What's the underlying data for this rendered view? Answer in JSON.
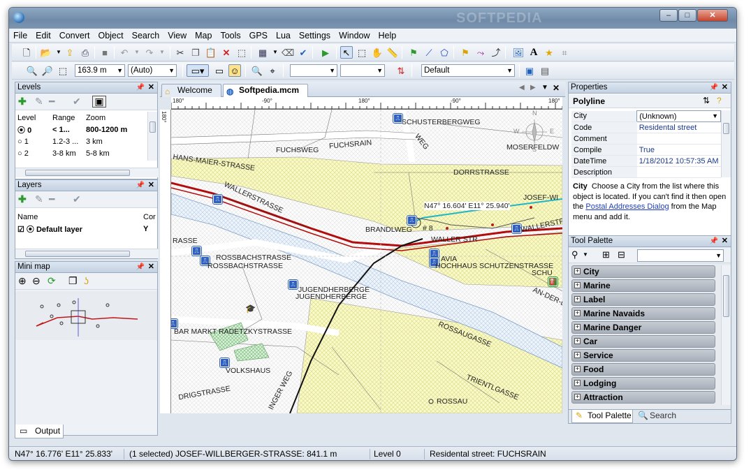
{
  "window": {
    "brand_watermark": "SOFTPEDIA",
    "min": "–",
    "max": "□",
    "close": "✕"
  },
  "menu": [
    "File",
    "Edit",
    "Convert",
    "Object",
    "Search",
    "View",
    "Map",
    "Tools",
    "GPS",
    "Lua",
    "Settings",
    "Window",
    "Help"
  ],
  "toolbar2": {
    "zoom_value": "163.9 m",
    "zoom_mode": "(Auto)",
    "style_value": "Default"
  },
  "levels_panel": {
    "title": "Levels",
    "columns": [
      "Level",
      "Range",
      "Zoom"
    ],
    "rows": [
      {
        "level": "0",
        "range": "< 1...",
        "zoom": "800-1200 m",
        "bold": true
      },
      {
        "level": "1",
        "range": "1.2-3 ...",
        "zoom": "3 km",
        "bold": false
      },
      {
        "level": "2",
        "range": "3-8 km",
        "zoom": "5-8 km",
        "bold": false
      }
    ]
  },
  "layers_panel": {
    "title": "Layers",
    "columns": [
      "Name",
      "Cor"
    ],
    "rows": [
      {
        "name": "Default layer",
        "flag": "Y"
      }
    ]
  },
  "minimap_panel": {
    "title": "Mini map"
  },
  "doc_tabs": [
    {
      "label": "Welcome"
    },
    {
      "label": "Softpedia.mcm"
    }
  ],
  "ruler_labels": [
    "180°",
    "-90°",
    "180°",
    "-90°",
    "180°",
    "180°"
  ],
  "map_labels": {
    "schusterbergweg": "SCHUSTERBERGWEG",
    "weg": "WEG",
    "fuchsweg": "FUCHSWEG",
    "fuchsrain": "FUCHSRAIN",
    "moserfeldweg": "MOSERFELDW",
    "hansmaier": "HANS-MAIER-STRASSE",
    "dorrstrasse": "DORRSTRASSE",
    "josefwi": "JOSEF-WI",
    "wallerstrasse1": "WALLERSTRASSE",
    "wallerstrasse2": "WALLERSTR",
    "wallerstrasse3": "WALLER STR",
    "brandlweg": "BRANDLWEG",
    "coords": "N47° 16.604' E11° 25.940'",
    "mark": "# 8",
    "rossbach1": "ROSSBACHSTRASSE",
    "rossbach2": "ROSSBACHSTRASSE",
    "strasse": "RASSE",
    "hochhaus": "HOCHHAUS SCHUTZENSTRASSE",
    "avia": "AVIA",
    "schu": "SCHU",
    "jugend1": "JUGENDHERBERGE",
    "jugend2": "JUGENDHERBERGE",
    "anderlan": "AN-DER-L",
    "badetzky": "BAR MARKT RADETZKYSTRASSE",
    "rossaugasse": "ROSSAUGASSE",
    "volkshaus": "VOLKSHAUS",
    "ingerweg": "INGER WEG",
    "trientlgasse": "TRIENTLGASSE",
    "rossau": "ROSSAU",
    "drigst": "DRIGSTRASSE",
    "compass_n": "N",
    "compass_s": "S",
    "compass_e": "E",
    "compass_w": "W"
  },
  "properties_panel": {
    "title": "Properties",
    "object_type": "Polyline",
    "rows": [
      {
        "key": "City",
        "value": "(Unknown)"
      },
      {
        "key": "Code",
        "value": "Residental street"
      },
      {
        "key": "Comment",
        "value": ""
      },
      {
        "key": "Compile",
        "value": "True"
      },
      {
        "key": "DateTime",
        "value": "1/18/2012 10:57:35 AM"
      },
      {
        "key": "Description",
        "value": ""
      }
    ],
    "help_title": "City",
    "help_text_1": "Choose a City from the list where this object is located. If you can't find it then open the",
    "help_link": "Postal Addresses Dialog",
    "help_text_2": "from the Map menu and add it."
  },
  "tool_palette": {
    "title": "Tool Palette",
    "items": [
      "City",
      "Marine",
      "Label",
      "Marine Navaids",
      "Marine Danger",
      "Car",
      "Service",
      "Food",
      "Lodging",
      "Attraction"
    ],
    "tabs": [
      "Tool Palette",
      "Search"
    ]
  },
  "output_tab": "Output",
  "status": {
    "coords": "N47° 16.776' E11° 25.833'",
    "selection": "(1 selected) JOSEF-WILLBERGER-STRASSE: 841.1 m",
    "level": "Level 0",
    "info": "Residental street: FUCHSRAIN"
  }
}
